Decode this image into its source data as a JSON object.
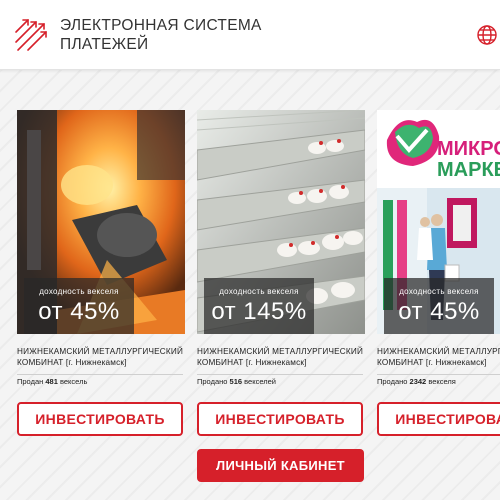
{
  "header": {
    "title_line1": "ЭЛЕКТРОННАЯ СИСТЕМА",
    "title_line2": "ПЛАТЕЖЕЙ",
    "logo_icon": "arrows-logo-icon",
    "globe_icon": "globe-icon"
  },
  "colors": {
    "accent": "#d6202a",
    "background": "#f4f4f4"
  },
  "cards": [
    {
      "image_icon": "steel-mill-image",
      "yield_label": "доходность векселя",
      "yield_value": "от 45%",
      "company_line1": "НИЖНЕКАМСКИЙ МЕТАЛЛУРГИЧЕСКИЙ",
      "company_line2": "КОМБИНАТ [г. Нижнекамск]",
      "sold_prefix": "Продан",
      "sold_count": "481",
      "sold_suffix": "вексель",
      "invest_label": "ИНВЕСТИРОВАТЬ"
    },
    {
      "image_icon": "poultry-farm-image",
      "yield_label": "доходность векселя",
      "yield_value": "от 145%",
      "company_line1": "НИЖНЕКАМСКИЙ МЕТАЛЛУРГИЧЕСКИЙ",
      "company_line2": "КОМБИНАТ [г. Нижнекамск]",
      "sold_prefix": "Продано",
      "sold_count": "516",
      "sold_suffix": "векселей",
      "invest_label": "ИНВЕСТИРОВАТЬ"
    },
    {
      "image_icon": "mini-market-image",
      "image_text_1": "МИКРО",
      "image_text_2": "МАРКЕ",
      "yield_label": "доходность векселя",
      "yield_value": "от 45%",
      "company_line1": "НИЖНЕКАМСКИЙ МЕТАЛЛУРГИЧ",
      "company_line2": "КОМБИНАТ [г. Нижнекамск]",
      "sold_prefix": "Продано",
      "sold_count": "2342",
      "sold_suffix": "векселя",
      "invest_label": "ИНВЕСТИРОВАТЬ"
    }
  ],
  "cabinet_button": "ЛИЧНЫЙ КАБИНЕТ"
}
